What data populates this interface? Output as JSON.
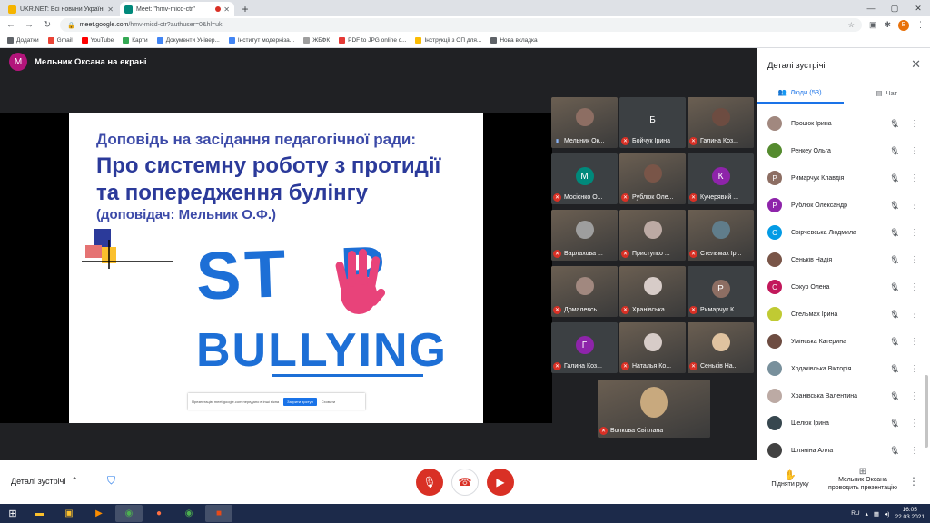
{
  "browser": {
    "tabs": [
      {
        "title": "UKR.NET: Всі новини України, с",
        "favicon_color": "#f5b400",
        "active": false
      },
      {
        "title": "Meet: \"hmv-micd-ctr\"",
        "favicon_color": "#00897b",
        "active": true
      }
    ],
    "url_host": "meet.google.com",
    "url_path": "/hmv-micd-ctr?authuser=0&hl=uk",
    "profile_initial": "Б",
    "bookmarks": [
      {
        "label": "Додатки",
        "color": "#5f6368"
      },
      {
        "label": "Gmail",
        "color": "#ea4335"
      },
      {
        "label": "YouTube",
        "color": "#ff0000"
      },
      {
        "label": "Карти",
        "color": "#34a853"
      },
      {
        "label": "Документи Універ...",
        "color": "#4285f4"
      },
      {
        "label": "Інститут модерніза...",
        "color": "#4285f4"
      },
      {
        "label": "ЖБФК",
        "color": "#9e9e9e"
      },
      {
        "label": "PDF to JPG online c...",
        "color": "#e53935"
      },
      {
        "label": "Інструкції з ОП для...",
        "color": "#fbbc04"
      },
      {
        "label": "Нова вкладка",
        "color": "#5f6368"
      }
    ]
  },
  "presenter": {
    "initial": "М",
    "label": "Мельник Оксана на екрані"
  },
  "slide": {
    "line1": "Доповідь на засідання педагогічної ради:",
    "line2": "Про системну роботу з протидії",
    "line3": "та попередження булінгу",
    "line4": "(доповідач: Мельник О.Ф.)",
    "stop_left": "ST",
    "stop_right": "P",
    "bullying": "BULLYING",
    "share_text": "Презентацію meet.google.com передано в інші вікна",
    "share_button": "Закрити доступ",
    "share_hide": "Сховати"
  },
  "tiles": [
    {
      "name": "Мельник Ок...",
      "initial": "",
      "color": "#8d6e63",
      "muted": false
    },
    {
      "name": "Бойчук Ірина",
      "initial": "Б",
      "color": "#3c4043",
      "muted": true
    },
    {
      "name": "Галина Коз...",
      "initial": "",
      "color": "#6d4c41",
      "muted": true
    },
    {
      "name": "Мосієнко О...",
      "initial": "М",
      "color": "#00897b",
      "muted": true
    },
    {
      "name": "Рублюк Оле...",
      "initial": "",
      "color": "#795548",
      "muted": true
    },
    {
      "name": "Кучерявий ...",
      "initial": "К",
      "color": "#8e24aa",
      "muted": true
    },
    {
      "name": "Варлахова ...",
      "initial": "",
      "color": "#9e9e9e",
      "muted": true
    },
    {
      "name": "Приступко ...",
      "initial": "",
      "color": "#bcaaa4",
      "muted": true
    },
    {
      "name": "Стельмах Ір...",
      "initial": "",
      "color": "#607d8b",
      "muted": true
    },
    {
      "name": "Домалевсь...",
      "initial": "",
      "color": "#a1887f",
      "muted": true
    },
    {
      "name": "Хранівська ...",
      "initial": "",
      "color": "#d7ccc8",
      "muted": true
    },
    {
      "name": "Римарчук К...",
      "initial": "Р",
      "color": "#8d6e63",
      "muted": true
    },
    {
      "name": "Галина Коз...",
      "initial": "Г",
      "color": "#8e24aa",
      "muted": true
    },
    {
      "name": "Наталья Ко...",
      "initial": "",
      "color": "#d7ccc8",
      "muted": true
    },
    {
      "name": "Сенькiв На...",
      "initial": "",
      "color": "#e0c3a0",
      "muted": true
    },
    {
      "name": "Волкова Світлана",
      "initial": "",
      "color": "#c8a97e",
      "muted": true
    }
  ],
  "panel": {
    "title": "Деталі зустрічі",
    "tab_people": "Люди (53)",
    "tab_chat": "Чат",
    "people": [
      {
        "name": "Процюк Ірина",
        "initial": "",
        "color": "#a1887f"
      },
      {
        "name": "Ренкеу Ольга",
        "initial": "",
        "color": "#558b2f"
      },
      {
        "name": "Римарчук Клавдія",
        "initial": "Р",
        "color": "#8d6e63"
      },
      {
        "name": "Рублюк Олександр",
        "initial": "Р",
        "color": "#8e24aa"
      },
      {
        "name": "Свірчевська Людмила",
        "initial": "С",
        "color": "#039be5"
      },
      {
        "name": "Сенькiв Надія",
        "initial": "",
        "color": "#795548"
      },
      {
        "name": "Сокур Олена",
        "initial": "С",
        "color": "#c2185b"
      },
      {
        "name": "Стельмах Ірина",
        "initial": "",
        "color": "#c0ca33"
      },
      {
        "name": "Умінська Катерина",
        "initial": "",
        "color": "#6d4c41"
      },
      {
        "name": "Ходаківська Вікторія",
        "initial": "",
        "color": "#78909c"
      },
      {
        "name": "Хранівська Валентина",
        "initial": "",
        "color": "#bcaaa4"
      },
      {
        "name": "Шелюк Ірина",
        "initial": "",
        "color": "#37474f"
      },
      {
        "name": "Шляніна Алла",
        "initial": "",
        "color": "#424242"
      }
    ]
  },
  "bottom": {
    "details_label": "Деталі зустрічі",
    "raise_hand": "Підняти руку",
    "presenting_line1": "Мельник Оксана",
    "presenting_line2": "проводить презентацію"
  },
  "taskbar": {
    "lang": "RU",
    "time": "16:05",
    "date": "22.03.2021"
  }
}
